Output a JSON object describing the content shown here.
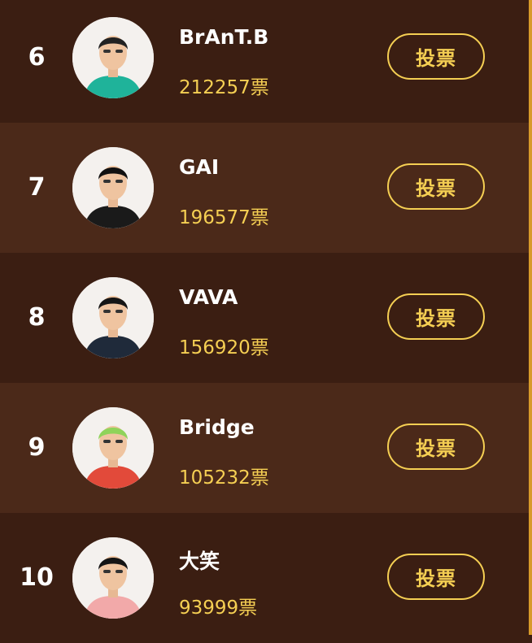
{
  "ranking": [
    {
      "rank": "6",
      "name": "BrAnT.B",
      "votes": "212257票",
      "vote_label": "投票",
      "avatar": "avatar-brantb",
      "shirt_color": "#1fb39a",
      "hair_color": "#222222"
    },
    {
      "rank": "7",
      "name": "GAI",
      "votes": "196577票",
      "vote_label": "投票",
      "avatar": "avatar-gai",
      "shirt_color": "#1a1a1a",
      "hair_color": "#111111"
    },
    {
      "rank": "8",
      "name": "VAVA",
      "votes": "156920票",
      "vote_label": "投票",
      "avatar": "avatar-vava",
      "shirt_color": "#1f2a3a",
      "hair_color": "#151515"
    },
    {
      "rank": "9",
      "name": "Bridge",
      "votes": "105232票",
      "vote_label": "投票",
      "avatar": "avatar-bridge",
      "shirt_color": "#e24a3a",
      "hair_color": "#8fd35a"
    },
    {
      "rank": "10",
      "name": "大笑",
      "votes": "93999票",
      "vote_label": "投票",
      "avatar": "avatar-daxiao",
      "shirt_color": "#f2a9a9",
      "hair_color": "#141414"
    }
  ],
  "colors": {
    "background_dark": "#3b1e12",
    "background_light": "#4b2919",
    "accent_gold": "#f5cf53",
    "text_white": "#ffffff"
  }
}
